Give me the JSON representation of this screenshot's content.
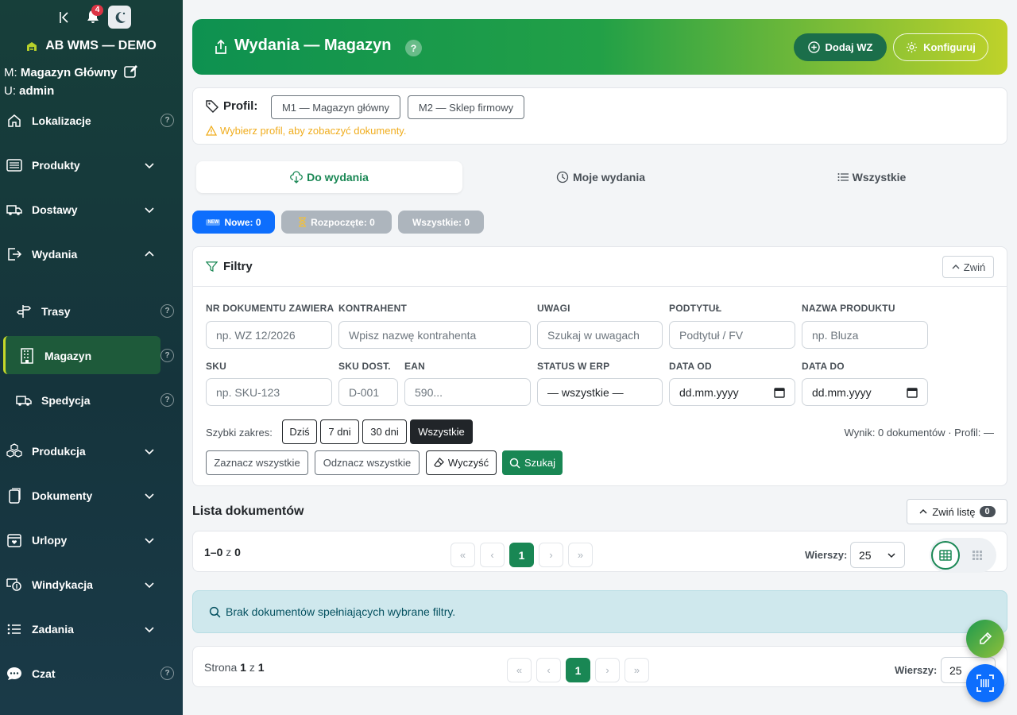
{
  "app": {
    "name": "AB WMS — DEMO",
    "notifications": "4"
  },
  "context": {
    "warehouse_label": "M:",
    "warehouse": "Magazyn Główny",
    "user_label": "U:",
    "user": "admin"
  },
  "sidebar": {
    "items": [
      {
        "label": "Lokalizacje",
        "icon": "home-icon"
      },
      {
        "label": "Produkty",
        "icon": "list-box-icon"
      },
      {
        "label": "Dostawy",
        "icon": "truck-icon"
      },
      {
        "label": "Wydania",
        "icon": "box-arrow-right-icon"
      },
      {
        "label": "Trasy",
        "icon": "signpost-icon"
      },
      {
        "label": "Magazyn",
        "icon": "building-icon"
      },
      {
        "label": "Spedycja",
        "icon": "truck-icon"
      },
      {
        "label": "Produkcja",
        "icon": "boxes-icon"
      },
      {
        "label": "Dokumenty",
        "icon": "files-icon"
      },
      {
        "label": "Urlopy",
        "icon": "calendar-heart-icon"
      },
      {
        "label": "Windykacja",
        "icon": "cash-coin-icon"
      },
      {
        "label": "Zadania",
        "icon": "list-ul-icon"
      },
      {
        "label": "Czat",
        "icon": "chat-icon"
      }
    ]
  },
  "header": {
    "title": "Wydania — Magazyn",
    "help": "?",
    "add_button": "Dodaj WZ",
    "config_button": "Konfiguruj"
  },
  "profile": {
    "label": "Profil:",
    "options": [
      "M1 — Magazyn główny",
      "M2 — Sklep firmowy"
    ],
    "warning": "Wybierz profil, aby zobaczyć dokumenty."
  },
  "tabs": [
    {
      "label": "Do wydania",
      "active": true
    },
    {
      "label": "Moje wydania",
      "active": false
    },
    {
      "label": "Wszystkie",
      "active": false
    }
  ],
  "counters": {
    "new": "Nowe: 0",
    "new_badge": "NEW",
    "started": "Rozpoczęte: 0",
    "all": "Wszystkie: 0"
  },
  "filters": {
    "title": "Filtry",
    "collapse": "Zwiń",
    "fields": {
      "doc_no": {
        "label": "NR DOKUMENTU ZAWIERA",
        "placeholder": "np. WZ 12/2026"
      },
      "contractor": {
        "label": "KONTRAHENT",
        "placeholder": "Wpisz nazwę kontrahenta"
      },
      "notes": {
        "label": "UWAGI",
        "placeholder": "Szukaj w uwagach"
      },
      "subtitle": {
        "label": "PODTYTUŁ",
        "placeholder": "Podtytuł / FV"
      },
      "product": {
        "label": "NAZWA PRODUKTU",
        "placeholder": "np. Bluza"
      },
      "sku": {
        "label": "SKU",
        "placeholder": "np. SKU-123"
      },
      "sku_supplier": {
        "label": "SKU DOST.",
        "placeholder": "D-001"
      },
      "ean": {
        "label": "EAN",
        "placeholder": "590..."
      },
      "erp_status": {
        "label": "STATUS W ERP",
        "value": "— wszystkie —"
      },
      "date_from": {
        "label": "DATA OD",
        "value": "dd.mm.yyyy"
      },
      "date_to": {
        "label": "DATA DO",
        "value": "dd.mm.yyyy"
      }
    },
    "quick_label": "Szybki zakres:",
    "quick": [
      "Dziś",
      "7 dni",
      "30 dni",
      "Wszystkie"
    ],
    "result": "Wynik: 0 dokumentów · Profil: —",
    "actions": {
      "select_all": "Zaznacz wszystkie",
      "deselect_all": "Odznacz wszystkie",
      "clear": "Wyczyść",
      "search": "Szukaj"
    }
  },
  "list": {
    "title": "Lista dokumentów",
    "collapse": "Zwiń listę",
    "count": "0",
    "range_a": "1–0",
    "range_of": "z",
    "range_b": "0",
    "rows_label": "Wierszy:",
    "rows": "25",
    "current_page": "1",
    "empty": "Brak dokumentów spełniających wybrane filtry.",
    "footer_page_label": "Strona",
    "footer_page": "1",
    "footer_of": "z",
    "footer_total": "1"
  }
}
